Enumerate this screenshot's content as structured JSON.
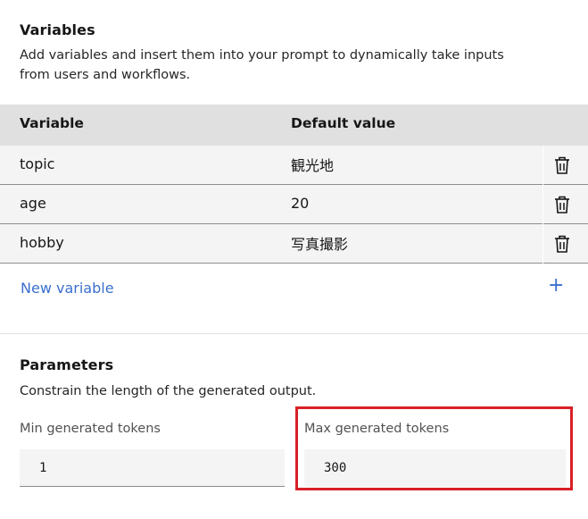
{
  "variables": {
    "title": "Variables",
    "description_line1": "Add variables and insert them into your prompt to dynamically take inputs",
    "description_line2": "from users and workflows.",
    "columns": {
      "variable": "Variable",
      "default_value": "Default value"
    },
    "rows": [
      {
        "name": "topic",
        "value": "観光地"
      },
      {
        "name": "age",
        "value": "20"
      },
      {
        "name": "hobby",
        "value": "写真撮影"
      }
    ],
    "add_label": "New variable",
    "add_icon": "+"
  },
  "parameters": {
    "title": "Parameters",
    "description": "Constrain the length of the generated output.",
    "min_tokens": {
      "label": "Min generated tokens",
      "value": "1"
    },
    "max_tokens": {
      "label": "Max generated tokens",
      "value": "300"
    }
  },
  "colors": {
    "accent": "#3a6fcf",
    "highlight": "#d92027",
    "header_bg": "#e0e0e0",
    "row_bg": "#f4f4f4"
  }
}
